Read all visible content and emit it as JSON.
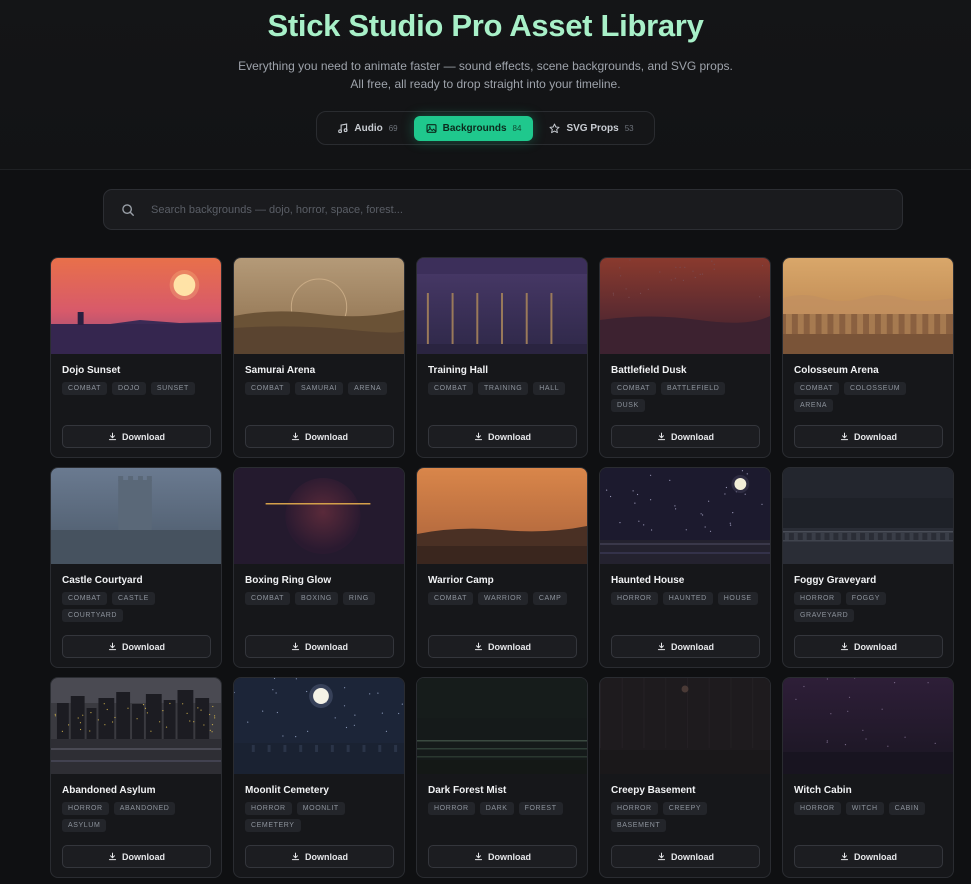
{
  "header": {
    "title": "Stick Studio Pro Asset Library",
    "subtitle_line1": "Everything you need to animate faster — sound effects, scene backgrounds, and SVG props.",
    "subtitle_line2": "All free, all ready to drop straight into your timeline."
  },
  "tabs": [
    {
      "label": "Audio",
      "count": "69",
      "icon": "music-note-icon"
    },
    {
      "label": "Backgrounds",
      "count": "84",
      "icon": "image-icon",
      "active": true
    },
    {
      "label": "SVG Props",
      "count": "53",
      "icon": "star-icon"
    }
  ],
  "search": {
    "placeholder": "Search backgrounds — dojo, horror, space, forest..."
  },
  "download_label": "Download",
  "cards": [
    {
      "name": "Dojo Sunset",
      "tags": [
        "COMBAT",
        "DOJO",
        "SUNSET"
      ],
      "scene": "dojo"
    },
    {
      "name": "Samurai Arena",
      "tags": [
        "COMBAT",
        "SAMURAI",
        "ARENA"
      ],
      "scene": "samurai"
    },
    {
      "name": "Training Hall",
      "tags": [
        "COMBAT",
        "TRAINING",
        "HALL"
      ],
      "scene": "training"
    },
    {
      "name": "Battlefield Dusk",
      "tags": [
        "COMBAT",
        "BATTLEFIELD",
        "DUSK"
      ],
      "scene": "battlefield"
    },
    {
      "name": "Colosseum Arena",
      "tags": [
        "COMBAT",
        "COLOSSEUM",
        "ARENA"
      ],
      "scene": "colosseum"
    },
    {
      "name": "Castle Courtyard",
      "tags": [
        "COMBAT",
        "CASTLE",
        "COURTYARD"
      ],
      "scene": "castle"
    },
    {
      "name": "Boxing Ring Glow",
      "tags": [
        "COMBAT",
        "BOXING",
        "RING"
      ],
      "scene": "boxing"
    },
    {
      "name": "Warrior Camp",
      "tags": [
        "COMBAT",
        "WARRIOR",
        "CAMP"
      ],
      "scene": "warrior"
    },
    {
      "name": "Haunted House",
      "tags": [
        "HORROR",
        "HAUNTED",
        "HOUSE"
      ],
      "scene": "haunted"
    },
    {
      "name": "Foggy Graveyard",
      "tags": [
        "HORROR",
        "FOGGY",
        "GRAVEYARD"
      ],
      "scene": "graveyard"
    },
    {
      "name": "Abandoned Asylum",
      "tags": [
        "HORROR",
        "ABANDONED",
        "ASYLUM"
      ],
      "scene": "asylum"
    },
    {
      "name": "Moonlit Cemetery",
      "tags": [
        "HORROR",
        "MOONLIT",
        "CEMETERY"
      ],
      "scene": "cemetery"
    },
    {
      "name": "Dark Forest Mist",
      "tags": [
        "HORROR",
        "DARK",
        "FOREST"
      ],
      "scene": "forest"
    },
    {
      "name": "Creepy Basement",
      "tags": [
        "HORROR",
        "CREEPY",
        "BASEMENT"
      ],
      "scene": "basement"
    },
    {
      "name": "Witch Cabin",
      "tags": [
        "HORROR",
        "WITCH",
        "CABIN"
      ],
      "scene": "witch"
    }
  ]
}
